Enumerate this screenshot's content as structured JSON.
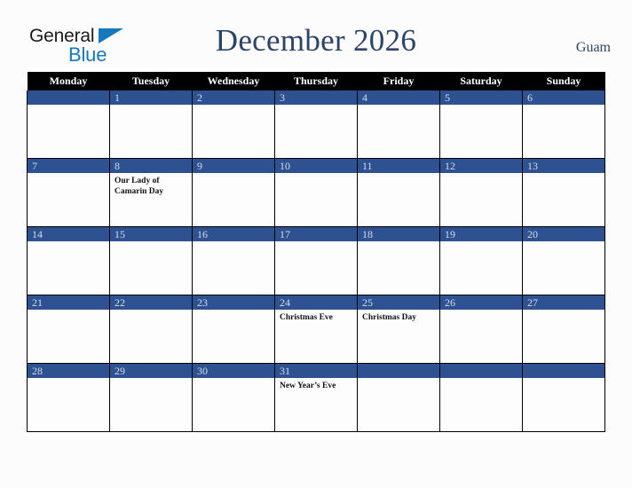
{
  "brand": {
    "name_part1": "General",
    "name_part2": "Blue",
    "triangle_icon": "triangle-icon",
    "accent_color": "#1878be"
  },
  "header": {
    "title": "December 2026",
    "locale": "Guam",
    "title_color": "#2b4468"
  },
  "calendar": {
    "month": "December",
    "year": "2026",
    "weekday_headers": [
      "Monday",
      "Tuesday",
      "Wednesday",
      "Thursday",
      "Friday",
      "Saturday",
      "Sunday"
    ],
    "header_bg": "#000000",
    "daybar_color": "#2e5192",
    "daynum_color": "#d7dce6",
    "weeks": [
      [
        {
          "day": "",
          "events": []
        },
        {
          "day": "1",
          "events": []
        },
        {
          "day": "2",
          "events": []
        },
        {
          "day": "3",
          "events": []
        },
        {
          "day": "4",
          "events": []
        },
        {
          "day": "5",
          "events": []
        },
        {
          "day": "6",
          "events": []
        }
      ],
      [
        {
          "day": "7",
          "events": []
        },
        {
          "day": "8",
          "events": [
            "Our Lady of Camarin Day"
          ]
        },
        {
          "day": "9",
          "events": []
        },
        {
          "day": "10",
          "events": []
        },
        {
          "day": "11",
          "events": []
        },
        {
          "day": "12",
          "events": []
        },
        {
          "day": "13",
          "events": []
        }
      ],
      [
        {
          "day": "14",
          "events": []
        },
        {
          "day": "15",
          "events": []
        },
        {
          "day": "16",
          "events": []
        },
        {
          "day": "17",
          "events": []
        },
        {
          "day": "18",
          "events": []
        },
        {
          "day": "19",
          "events": []
        },
        {
          "day": "20",
          "events": []
        }
      ],
      [
        {
          "day": "21",
          "events": []
        },
        {
          "day": "22",
          "events": []
        },
        {
          "day": "23",
          "events": []
        },
        {
          "day": "24",
          "events": [
            "Christmas Eve"
          ]
        },
        {
          "day": "25",
          "events": [
            "Christmas Day"
          ]
        },
        {
          "day": "26",
          "events": []
        },
        {
          "day": "27",
          "events": []
        }
      ],
      [
        {
          "day": "28",
          "events": []
        },
        {
          "day": "29",
          "events": []
        },
        {
          "day": "30",
          "events": []
        },
        {
          "day": "31",
          "events": [
            "New Year’s Eve"
          ]
        },
        {
          "day": "",
          "events": []
        },
        {
          "day": "",
          "events": []
        },
        {
          "day": "",
          "events": []
        }
      ]
    ]
  }
}
